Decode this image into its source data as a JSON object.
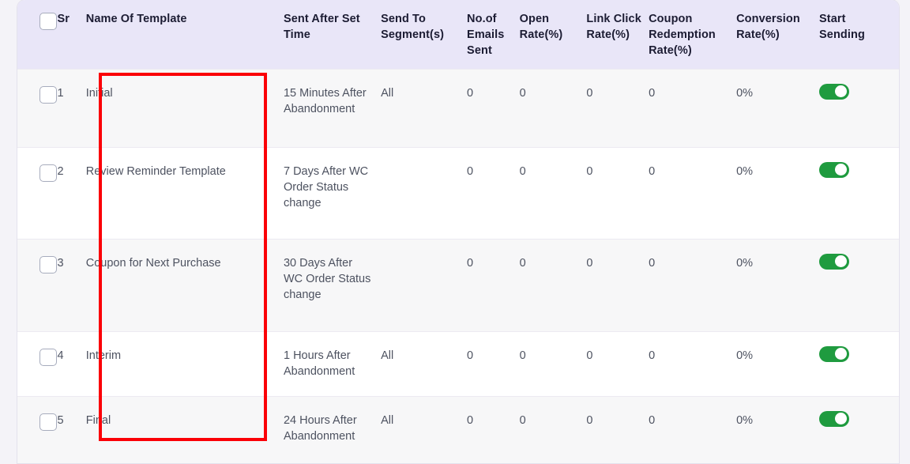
{
  "table": {
    "columns": [
      {
        "key": "select",
        "label": ""
      },
      {
        "key": "sr",
        "label": "Sr"
      },
      {
        "key": "name",
        "label": "Name Of Template"
      },
      {
        "key": "sent_after",
        "label": "Sent After Set Time"
      },
      {
        "key": "segments",
        "label": "Send To Segment(s)"
      },
      {
        "key": "emails",
        "label": "No.of Emails Sent"
      },
      {
        "key": "open",
        "label": "Open Rate(%)"
      },
      {
        "key": "click",
        "label": "Link Click Rate(%)"
      },
      {
        "key": "coupon",
        "label": "Coupon Redemption Rate(%)"
      },
      {
        "key": "conversion",
        "label": "Conversion Rate(%)"
      },
      {
        "key": "start",
        "label": "Start Sending"
      }
    ],
    "rows": [
      {
        "sr": "1",
        "name": "Initial",
        "sent_after": "15 Minutes After Abandonment",
        "segments": "All",
        "emails": "0",
        "open": "0",
        "click": "0",
        "coupon": "0",
        "conversion": "0%",
        "start_sending": "on",
        "selected": "false"
      },
      {
        "sr": "2",
        "name": "Review Reminder Template",
        "sent_after": "7 Days After WC Order Status change",
        "segments": "",
        "emails": "0",
        "open": "0",
        "click": "0",
        "coupon": "0",
        "conversion": "0%",
        "start_sending": "on",
        "selected": "false"
      },
      {
        "sr": "3",
        "name": "Coupon for Next Purchase",
        "sent_after": "30 Days After WC Order Status change",
        "segments": "",
        "emails": "0",
        "open": "0",
        "click": "0",
        "coupon": "0",
        "conversion": "0%",
        "start_sending": "on",
        "selected": "false"
      },
      {
        "sr": "4",
        "name": "Interim",
        "sent_after": "1 Hours After Abandonment",
        "segments": "All",
        "emails": "0",
        "open": "0",
        "click": "0",
        "coupon": "0",
        "conversion": "0%",
        "start_sending": "on",
        "selected": "false"
      },
      {
        "sr": "5",
        "name": "Final",
        "sent_after": "24 Hours After Abandonment",
        "segments": "All",
        "emails": "0",
        "open": "0",
        "click": "0",
        "coupon": "0",
        "conversion": "0%",
        "start_sending": "on",
        "selected": "false"
      }
    ]
  },
  "annotation": {
    "label": "name-of-template-column-highlight",
    "color": "#fb0007"
  },
  "colors": {
    "page_background": "#f4f3f8",
    "header_background": "#e9e6f8",
    "row_shaded": "#f7f7f8",
    "row_plain": "#ffffff",
    "toggle_on": "#1f9b3f",
    "header_text": "#1c1c33",
    "body_text": "#4d5260"
  }
}
